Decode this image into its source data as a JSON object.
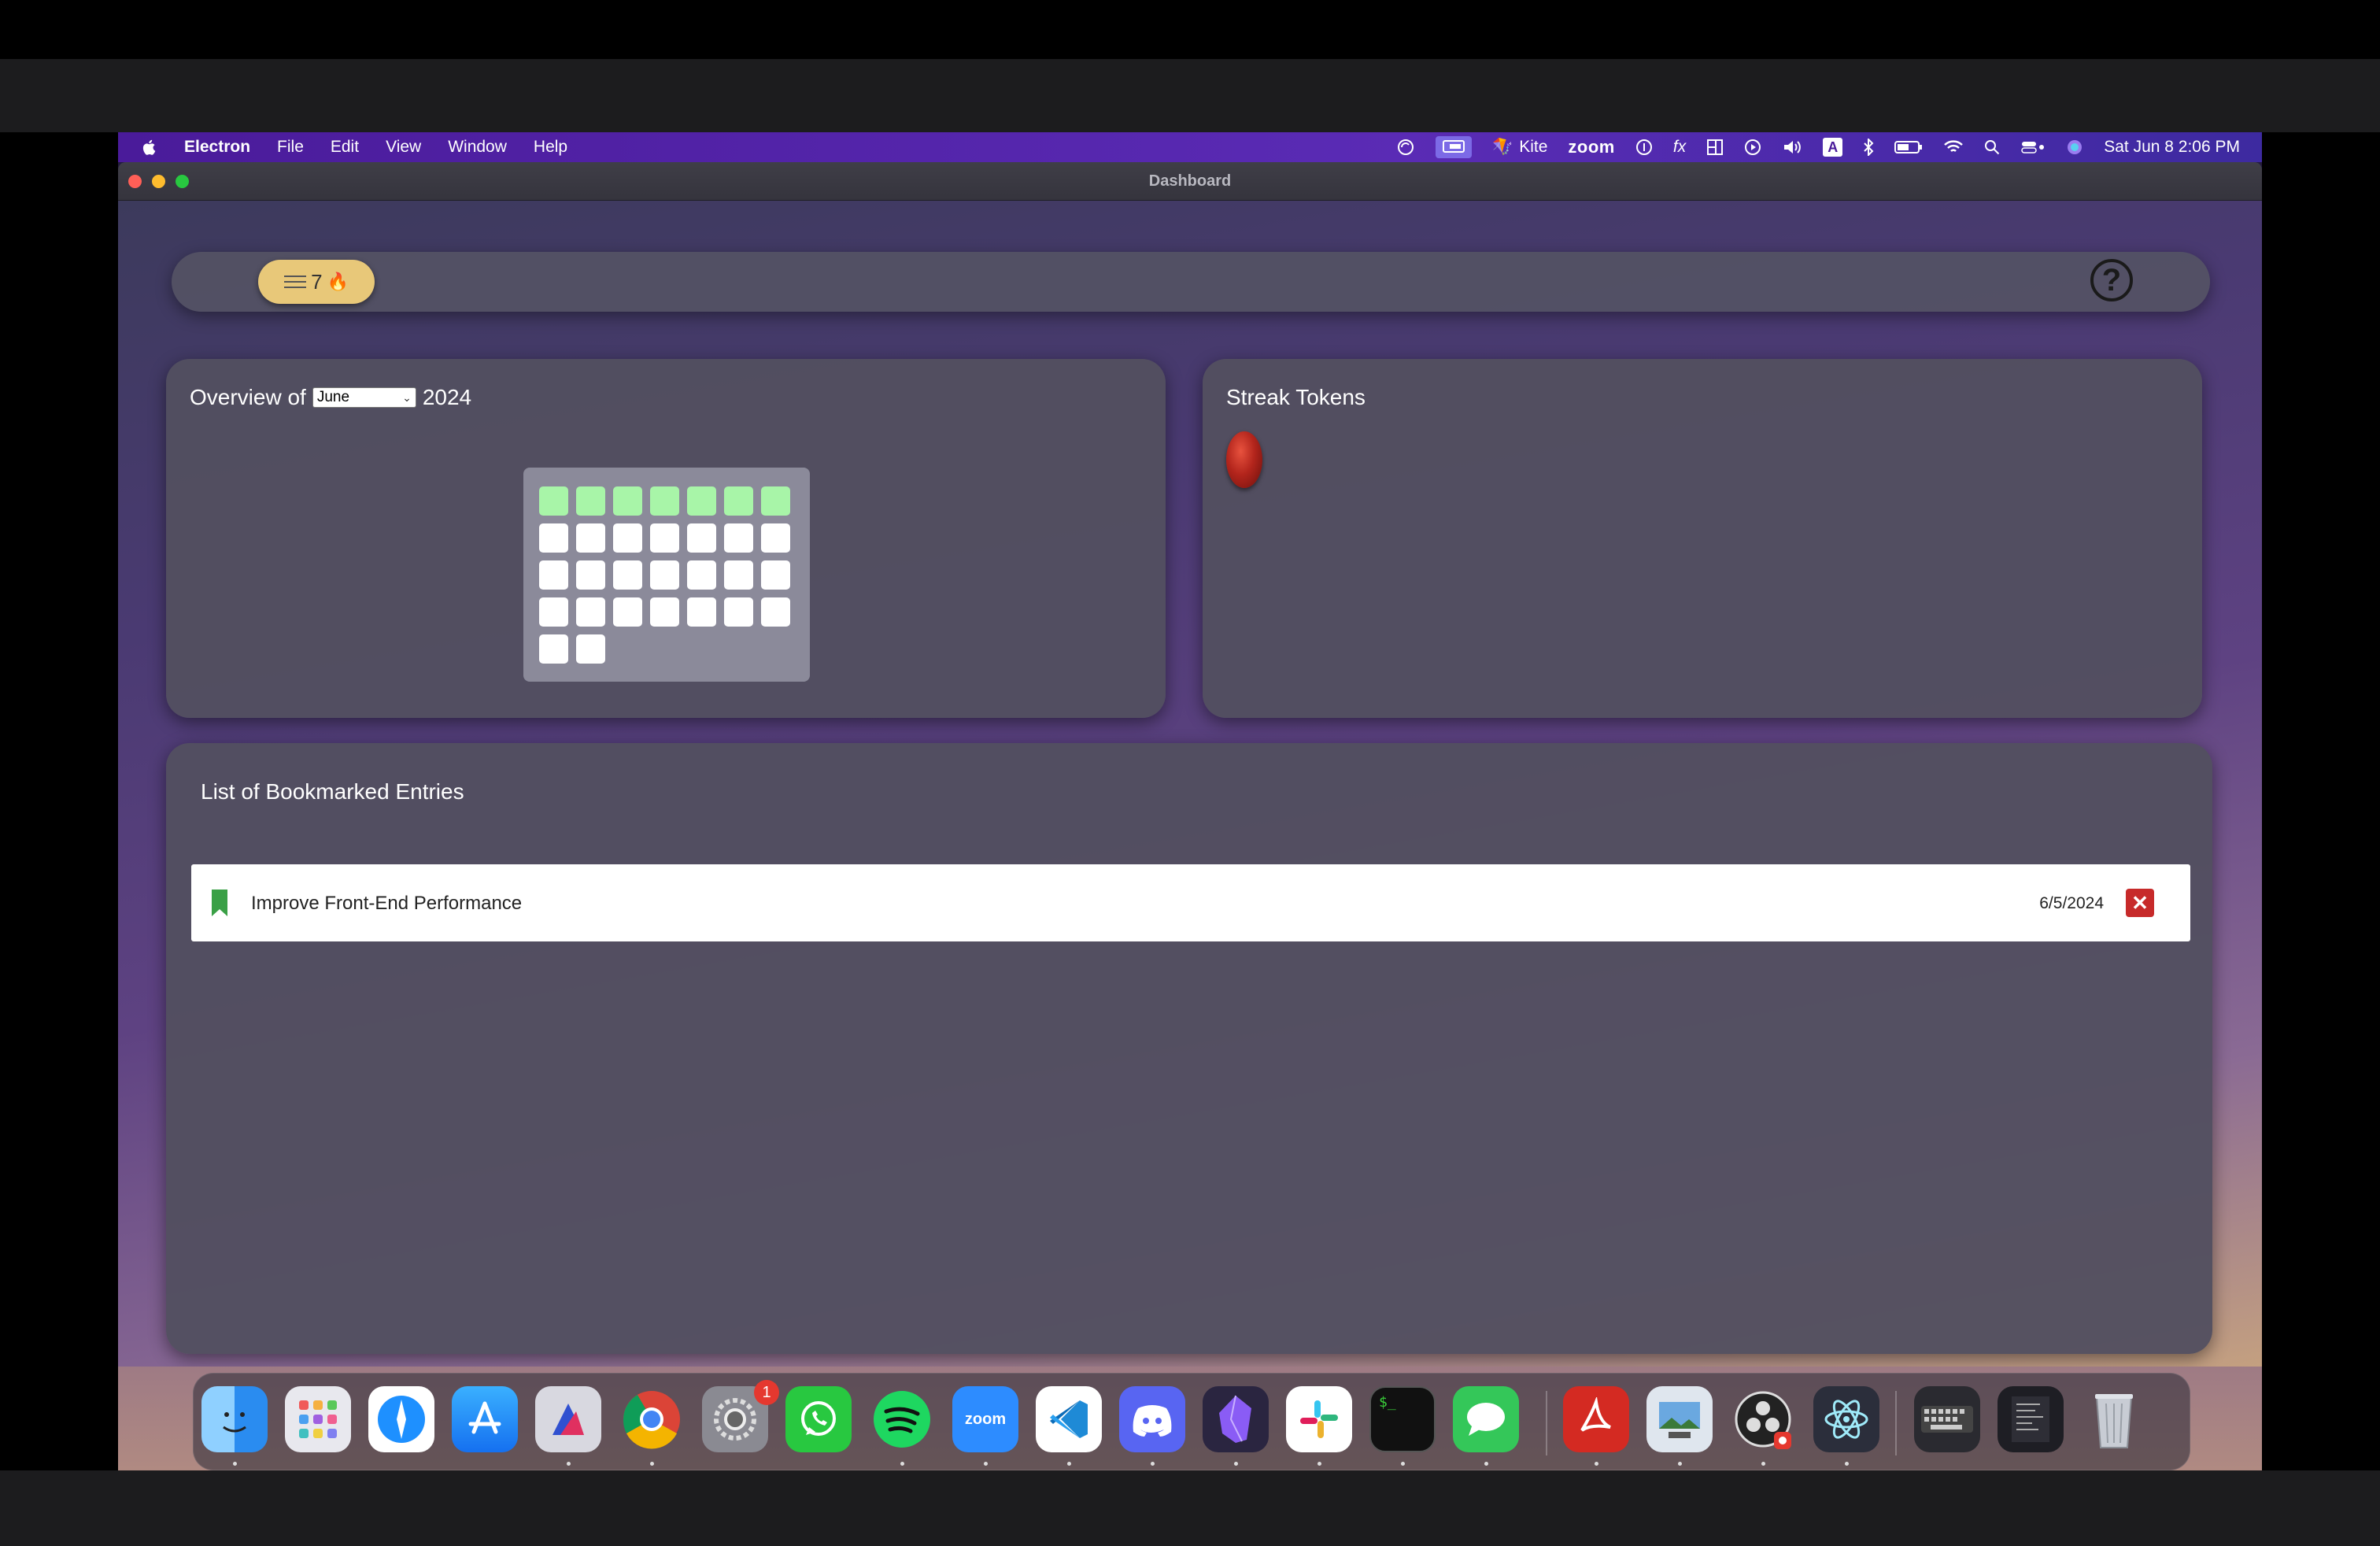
{
  "menubar": {
    "app_name": "Electron",
    "menus": [
      "File",
      "Edit",
      "View",
      "Window",
      "Help"
    ],
    "kite_label": "Kite",
    "zoom_label": "zoom",
    "input_source": "A",
    "fx_label": "fx",
    "datetime": "Sat Jun 8  2:06 PM"
  },
  "window": {
    "title": "Dashboard"
  },
  "topbar": {
    "streak_count": "7",
    "help_symbol": "?"
  },
  "overview": {
    "title_prefix": "Overview of",
    "month_selected": "June",
    "year": "2024",
    "days_total": 30,
    "days_completed": 7
  },
  "streak_tokens": {
    "title": "Streak Tokens",
    "token_count": 1
  },
  "bookmarks": {
    "title": "List of Bookmarked Entries",
    "entries": [
      {
        "title": "Improve Front-End Performance",
        "date": "6/5/2024"
      }
    ]
  },
  "dock": {
    "apps": [
      "finder",
      "launchpad",
      "safari",
      "app-store",
      "affinity",
      "chrome",
      "system-settings",
      "whatsapp",
      "spotify",
      "zoom",
      "vscode",
      "discord",
      "obsidian",
      "slack",
      "terminal",
      "messages",
      "acrobat",
      "preview",
      "obs",
      "electron",
      "dictionary",
      "text-edit",
      "trash"
    ],
    "settings_badge": "1",
    "zoom_label": "zoom"
  },
  "colors": {
    "completed_day": "#a8f5a8",
    "menubar": "#5a2bb5",
    "streak_pill": "#e8c879",
    "delete": "#c72a2a"
  }
}
